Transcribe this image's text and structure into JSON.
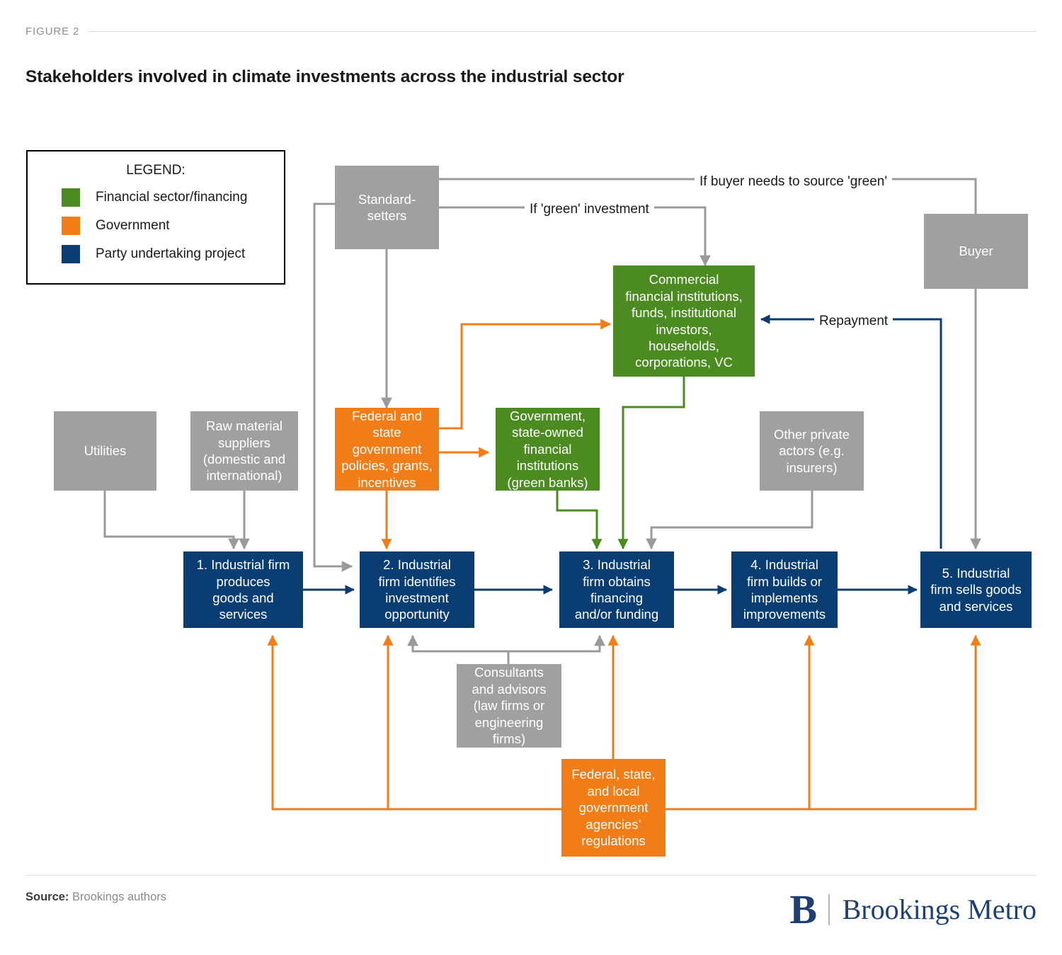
{
  "figure": {
    "label": "FIGURE 2",
    "title": "Stakeholders involved in climate investments across the industrial sector"
  },
  "legend": {
    "title": "LEGEND:",
    "items": [
      {
        "label": "Financial sector/financing",
        "color": "#4b8b21"
      },
      {
        "label": "Government",
        "color": "#f07d18"
      },
      {
        "label": "Party undertaking project",
        "color": "#0a3d72"
      }
    ]
  },
  "colors": {
    "gray": "#a0a0a0",
    "orange": "#f07d18",
    "green": "#4b8b21",
    "navy": "#0a3d72",
    "gray_line": "#9a9a9a"
  },
  "nodes": {
    "standard_setters": "Standard-\nsetters",
    "buyer": "Buyer",
    "commercial_financial": "Commercial\nfinancial institutions,\nfunds, institutional\ninvestors,\nhouseholds,\ncorporations, VC",
    "utilities": "Utilities",
    "raw_material_suppliers": "Raw material\nsuppliers\n(domestic and\ninternational)",
    "federal_state_government": "Federal and\nstate\ngovernment\npolicies, grants,\nincentives",
    "green_banks": "Government,\nstate-owned\nfinancial\ninstitutions\n(green banks)",
    "other_private_actors": "Other private\nactors (e.g.\ninsurers)",
    "step1": "1. Industrial firm\nproduces\ngoods and\nservices",
    "step2": "2. Industrial\nfirm identifies\ninvestment\nopportunity",
    "step3": "3. Industrial\nfirm obtains\nfinancing\nand/or funding",
    "step4": "4. Industrial\nfirm builds or\nimplements\nimprovements",
    "step5": "5. Industrial\nfirm sells goods\nand services",
    "consultants": "Consultants\nand advisors\n(law firms or\nengineering\nfirms)",
    "regulations": "Federal, state,\nand local\ngovernment\nagencies’\nregulations"
  },
  "edge_labels": {
    "if_buyer_green": "If buyer needs to source 'green'",
    "if_green_investment": "If 'green' investment",
    "repayment": "Repayment"
  },
  "footer": {
    "source_label": "Source:",
    "source_value": " Brookings authors",
    "logo_mark": "B",
    "logo_text": "Brookings Metro"
  }
}
